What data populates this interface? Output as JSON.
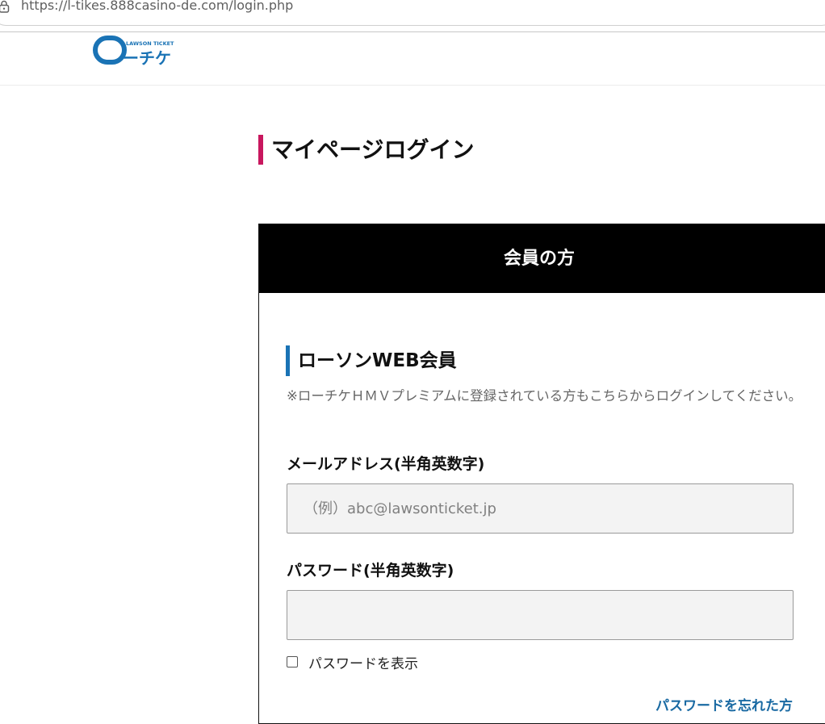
{
  "browser": {
    "url": "https://l-tikes.888casino-de.com/login.php",
    "lock_icon": "lock-icon"
  },
  "header": {
    "logo": {
      "small_text": "LAWSON TICKET",
      "main_text": "ーチケ",
      "brand_color": "#1a73b5"
    }
  },
  "page": {
    "title": "マイページログイン",
    "title_accent_color": "#c8175e"
  },
  "member_panel": {
    "header": "会員の方",
    "section_title": "ローソンWEB会員",
    "section_accent_color": "#1a73b5",
    "note": "※ローチケＨＭＶプレミアムに登録されている方もこちらからログインしてください。",
    "email": {
      "label": "メールアドレス(半角英数字)",
      "placeholder": "（例）abc@lawsonticket.jp",
      "value": ""
    },
    "password": {
      "label": "パスワード(半角英数字)",
      "placeholder": "",
      "value": ""
    },
    "show_password": {
      "label": "パスワードを表示",
      "checked": false
    },
    "forgot_password": "パスワードを忘れた方",
    "link_color": "#1a6aa3"
  }
}
